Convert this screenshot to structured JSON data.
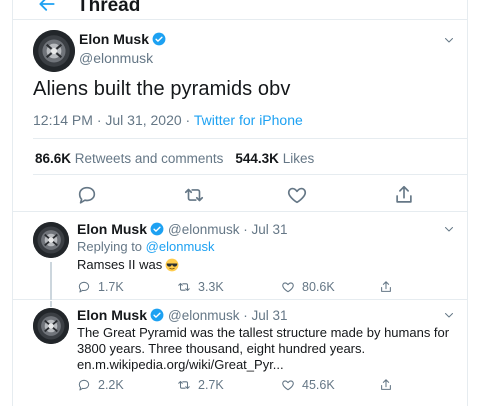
{
  "header": {
    "title": "Thread"
  },
  "main_tweet": {
    "author_name": "Elon Musk",
    "author_handle": "@elonmusk",
    "text": "Aliens built the pyramids obv",
    "timestamp": "12:14 PM · Jul 31, 2020 · ",
    "source": "Twitter for iPhone",
    "retweets_count": "86.6K",
    "retweets_label": "Retweets and comments",
    "likes_count": "544.3K",
    "likes_label": "Likes"
  },
  "replies": [
    {
      "author_name": "Elon Musk",
      "author_handle": "@elonmusk",
      "date": " · Jul 31",
      "replying_to_label": "Replying to",
      "replying_to_handle": "@elonmusk",
      "text": "Ramses II was",
      "emoji": "sunglasses-emoji",
      "reply_count": "1.7K",
      "retweet_count": "3.3K",
      "like_count": "80.6K"
    },
    {
      "author_name": "Elon Musk",
      "author_handle": "@elonmusk",
      "date": " · Jul 31",
      "text_line1": "The Great Pyramid was the tallest structure made by humans for",
      "text_line2": "3800 years. Three thousand, eight hundred years.",
      "link": "en.m.wikipedia.org/wiki/Great_Pyr...",
      "reply_count": "2.2K",
      "retweet_count": "2.7K",
      "like_count": "45.6K"
    }
  ],
  "colors": {
    "accent": "#1da1f2",
    "muted": "#657786",
    "text": "#14171a",
    "border": "#e6ecf0"
  },
  "icons": [
    "back-arrow-icon",
    "verified-badge-icon",
    "chevron-down-icon",
    "reply-icon",
    "retweet-icon",
    "like-icon",
    "share-icon"
  ]
}
